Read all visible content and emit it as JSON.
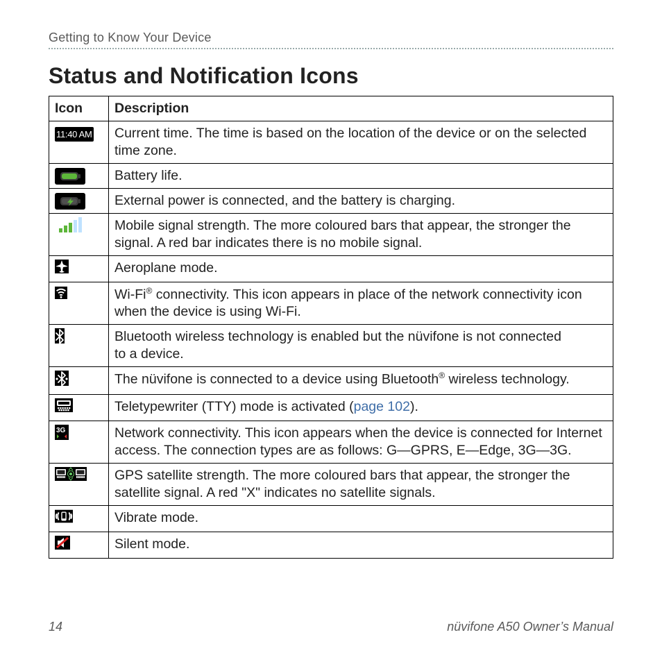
{
  "running_head": "Getting to Know Your Device",
  "title": "Status and Notification Icons",
  "table": {
    "headers": {
      "icon": "Icon",
      "description": "Description"
    },
    "rows": [
      {
        "icon_name": "time-icon",
        "desc_html": "Current time. The time is based on the location of the device or on the selected time zone.",
        "time_text": "11:40 AM"
      },
      {
        "icon_name": "battery-icon",
        "desc_html": "Battery life."
      },
      {
        "icon_name": "charging-icon",
        "desc_html": "External power is connected, and the battery is charging."
      },
      {
        "icon_name": "signal-icon",
        "desc_html": "Mobile signal strength. The more coloured bars that appear, the stronger the signal. A red bar indicates there is no mobile signal."
      },
      {
        "icon_name": "aeroplane-icon",
        "desc_html": "Aeroplane mode."
      },
      {
        "icon_name": "wifi-icon",
        "desc_html": "Wi-Fi<sup>®</sup> connectivity. This icon appears in place of the network connectivity icon when the device is using Wi-Fi."
      },
      {
        "icon_name": "bluetooth-icon",
        "desc_html": "Bluetooth wireless technology is enabled but the nüvifone is not connected to&nbsp;a&nbsp;device."
      },
      {
        "icon_name": "bluetooth-connected-icon",
        "desc_html": "The nüvifone is connected to a device using Bluetooth<sup>®</sup> wireless technology."
      },
      {
        "icon_name": "tty-icon",
        "desc_html": "Teletypewriter (TTY) mode is activated (<a class=\"page-ref\" data-name=\"page-ref-link\" data-interactable=\"true\">page 102</a>)."
      },
      {
        "icon_name": "network-3g-icon",
        "desc_html": "Network connectivity. This icon appears when the device is connected for Internet access. The connection types are as follows: G—GPRS, E—Edge, 3G—3G."
      },
      {
        "icon_name": "gps-icon",
        "desc_html": "GPS satellite strength. The more coloured bars that appear, the stronger the satellite signal. A red \"X\" indicates no satellite signals."
      },
      {
        "icon_name": "vibrate-icon",
        "desc_html": "Vibrate mode."
      },
      {
        "icon_name": "silent-icon",
        "desc_html": "Silent mode."
      }
    ]
  },
  "footer": {
    "page_number": "14",
    "book_title": "nüvifone A50 Owner’s Manual"
  }
}
